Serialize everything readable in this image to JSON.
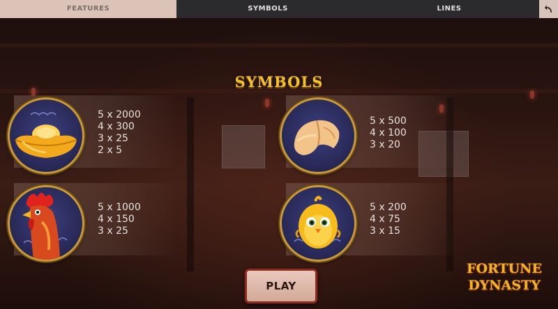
{
  "tabs": [
    {
      "label": "FEATURES",
      "active": true
    },
    {
      "label": "SYMBOLS",
      "active": false
    },
    {
      "label": "LINES",
      "active": false
    }
  ],
  "back_icon": "back-arrow-icon",
  "page_title": "SYMBOLS",
  "symbols": [
    {
      "icon": "gold-ingot-icon",
      "payouts": [
        "5 x 2000",
        "4 x 300",
        "3 x 25",
        "2 x 5"
      ]
    },
    {
      "icon": "fortune-cookie-icon",
      "payouts": [
        "5 x 500",
        "4 x 100",
        "3 x 20"
      ]
    },
    {
      "icon": "rooster-icon",
      "payouts": [
        "5 x 1000",
        "4 x 150",
        "3 x 25"
      ]
    },
    {
      "icon": "chick-icon",
      "payouts": [
        "5 x 200",
        "4 x 75",
        "3 x 15"
      ]
    }
  ],
  "play_label": "PLAY",
  "logo": {
    "line1": "FORTUNE",
    "line2": "DYNASTY"
  },
  "colors": {
    "title": "#f3c129",
    "coin_rim": "#c89a3a",
    "play_border": "#8b2b20"
  }
}
